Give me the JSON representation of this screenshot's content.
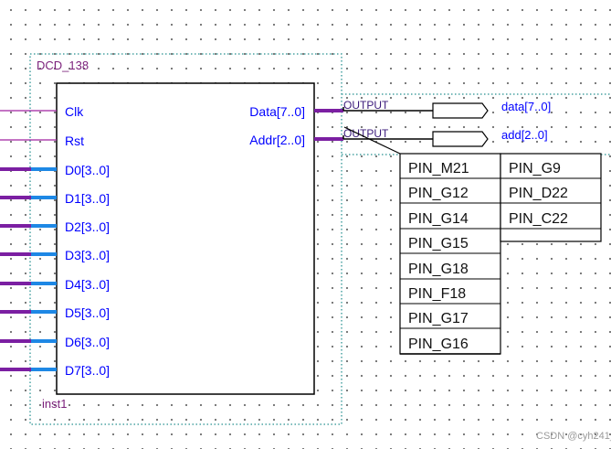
{
  "block": {
    "title": "DCD_138",
    "instance": "inst1",
    "inputs": [
      "Clk",
      "Rst",
      "D0[3..0]",
      "D1[3..0]",
      "D2[3..0]",
      "D3[3..0]",
      "D4[3..0]",
      "D5[3..0]",
      "D6[3..0]",
      "D7[3..0]"
    ],
    "outputs": [
      "Data[7..0]",
      "Addr[2..0]"
    ]
  },
  "output_pins": [
    {
      "type": "OUTPUT",
      "net": "data[7..0]"
    },
    {
      "type": "OUTPUT",
      "net": "add[2..0]"
    }
  ],
  "pin_assignments": {
    "left_column": [
      "PIN_M21",
      "PIN_G12",
      "PIN_G14",
      "PIN_G15",
      "PIN_G18",
      "PIN_F18",
      "PIN_G17",
      "PIN_G16"
    ],
    "right_column": [
      "PIN_G9",
      "PIN_D22",
      "PIN_C22"
    ]
  },
  "watermark": "CSDN @cyh241_",
  "colors": {
    "bus": "#7b1fa2",
    "input_bus": "#1e88e5",
    "wire": "#a020a0",
    "text_blue": "#0000ff",
    "dotted_frame": "#4aa3a3"
  }
}
